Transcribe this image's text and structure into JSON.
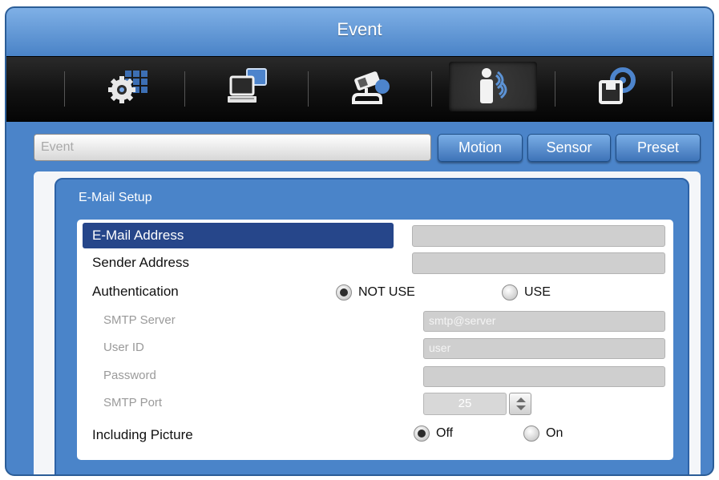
{
  "window": {
    "title": "Event"
  },
  "toolbar": {
    "icons": [
      "system-settings-icon",
      "network-icon",
      "ptz-icon",
      "event-icon",
      "backup-icon"
    ],
    "active_index": 3
  },
  "tabs": {
    "event_label": "Event",
    "motion": "Motion",
    "sensor": "Sensor",
    "preset": "Preset"
  },
  "email_setup": {
    "title": "E-Mail Setup",
    "email_address": {
      "label": "E-Mail Address",
      "value": ""
    },
    "sender_address": {
      "label": "Sender Address",
      "value": ""
    },
    "authentication": {
      "label": "Authentication",
      "option_not_use": "NOT USE",
      "option_use": "USE",
      "selected": "NOT USE"
    },
    "smtp_server": {
      "label": "SMTP Server",
      "value": "smtp@server"
    },
    "user_id": {
      "label": "User ID",
      "value": "user"
    },
    "password": {
      "label": "Password",
      "value": ""
    },
    "smtp_port": {
      "label": "SMTP Port",
      "value": "25"
    },
    "including_picture": {
      "label": "Including Picture",
      "option_off": "Off",
      "option_on": "On",
      "selected": "Off"
    }
  }
}
